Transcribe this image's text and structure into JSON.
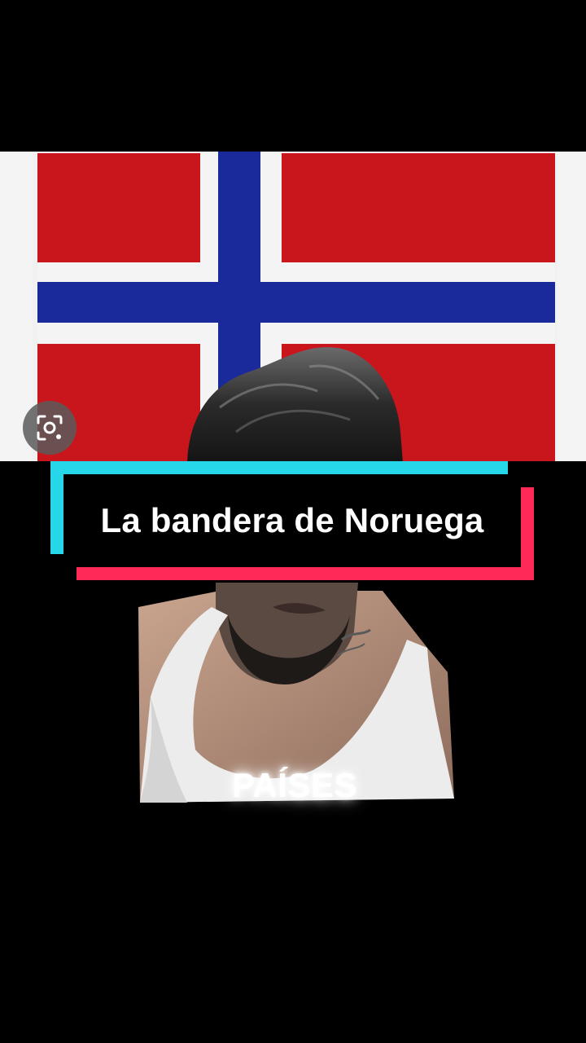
{
  "video": {
    "caption": "La bandera de Noruega",
    "overlay_word": "PAÍSES"
  },
  "flag": {
    "country": "Noruega",
    "colors": {
      "red": "#c8161c",
      "white": "#f4f4f4",
      "blue": "#1a2a9a"
    }
  },
  "icons": {
    "lens": "google-lens-icon"
  }
}
